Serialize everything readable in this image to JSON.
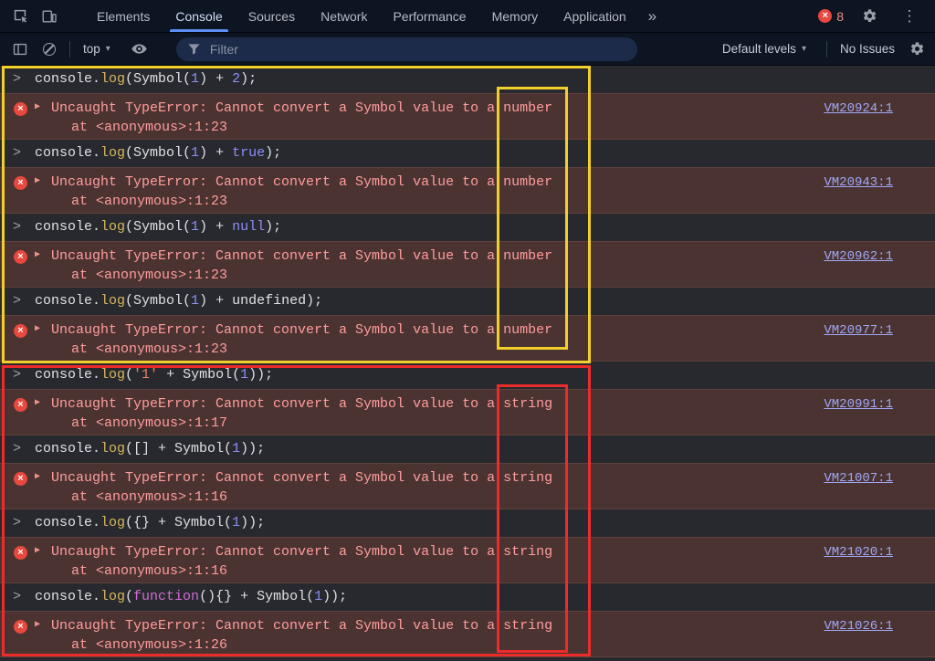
{
  "theme": {
    "toolbar_bg": "#0d1422",
    "console_bg": "#27292e",
    "tab_text": "#b6bcc4",
    "selected_tab_text": "#d3def7",
    "accent_blue": "#5b8ef5",
    "badge_red": "#e8483e",
    "filter_bg": "#1c2b49",
    "error_row_bg": "#4b3331",
    "error_border": "#5e413d",
    "error_text": "#ff9d9d",
    "link_color": "#9fa8f5",
    "annotation_yellow": "#f2cf2a",
    "annotation_red": "#ec2b2b",
    "token_plain": "#dfe1e5",
    "token_function": "#d8b65c",
    "token_number": "#8e8ef7",
    "token_keyword": "#8e8ef7",
    "token_string": "#ea8262",
    "token_function_keyword": "#d06ed0"
  },
  "icons": {
    "prompt": ">",
    "expand_triangle": "▶",
    "error_x": "×",
    "caret": "▾",
    "kebab": "⋮",
    "overflow_chevron": "»"
  },
  "tabbar": {
    "tabs": [
      "Elements",
      "Console",
      "Sources",
      "Network",
      "Performance",
      "Memory",
      "Application"
    ],
    "selected_tab": "Console",
    "error_count": "8"
  },
  "toolbar": {
    "context_label": "top",
    "filter_placeholder": "Filter",
    "filter_value": "",
    "levels_label": "Default levels",
    "issues_label": "No Issues"
  },
  "console": {
    "entries": [
      {
        "kind": "command",
        "segments": [
          {
            "text": "console.",
            "cls": "plain"
          },
          {
            "text": "log",
            "cls": "fn"
          },
          {
            "text": "(Symbol(",
            "cls": "plain"
          },
          {
            "text": "1",
            "cls": "num"
          },
          {
            "text": ") + ",
            "cls": "plain"
          },
          {
            "text": "2",
            "cls": "num"
          },
          {
            "text": ");",
            "cls": "plain"
          }
        ]
      },
      {
        "kind": "error",
        "message": "Uncaught TypeError: Cannot convert a Symbol value to a ",
        "word": "number",
        "location": "at <anonymous>:1:23",
        "link": "VM20924:1"
      },
      {
        "kind": "command",
        "segments": [
          {
            "text": "console.",
            "cls": "plain"
          },
          {
            "text": "log",
            "cls": "fn"
          },
          {
            "text": "(Symbol(",
            "cls": "plain"
          },
          {
            "text": "1",
            "cls": "num"
          },
          {
            "text": ") + ",
            "cls": "plain"
          },
          {
            "text": "true",
            "cls": "kw"
          },
          {
            "text": ");",
            "cls": "plain"
          }
        ]
      },
      {
        "kind": "error",
        "message": "Uncaught TypeError: Cannot convert a Symbol value to a ",
        "word": "number",
        "location": "at <anonymous>:1:23",
        "link": "VM20943:1"
      },
      {
        "kind": "command",
        "segments": [
          {
            "text": "console.",
            "cls": "plain"
          },
          {
            "text": "log",
            "cls": "fn"
          },
          {
            "text": "(Symbol(",
            "cls": "plain"
          },
          {
            "text": "1",
            "cls": "num"
          },
          {
            "text": ") + ",
            "cls": "plain"
          },
          {
            "text": "null",
            "cls": "kw"
          },
          {
            "text": ");",
            "cls": "plain"
          }
        ]
      },
      {
        "kind": "error",
        "message": "Uncaught TypeError: Cannot convert a Symbol value to a ",
        "word": "number",
        "location": "at <anonymous>:1:23",
        "link": "VM20962:1"
      },
      {
        "kind": "command",
        "segments": [
          {
            "text": "console.",
            "cls": "plain"
          },
          {
            "text": "log",
            "cls": "fn"
          },
          {
            "text": "(Symbol(",
            "cls": "plain"
          },
          {
            "text": "1",
            "cls": "num"
          },
          {
            "text": ") + undefined);",
            "cls": "plain"
          }
        ]
      },
      {
        "kind": "error",
        "message": "Uncaught TypeError: Cannot convert a Symbol value to a ",
        "word": "number",
        "location": "at <anonymous>:1:23",
        "link": "VM20977:1"
      },
      {
        "kind": "command",
        "segments": [
          {
            "text": "console.",
            "cls": "plain"
          },
          {
            "text": "log",
            "cls": "fn"
          },
          {
            "text": "(",
            "cls": "plain"
          },
          {
            "text": "'1'",
            "cls": "str"
          },
          {
            "text": " + Symbol(",
            "cls": "plain"
          },
          {
            "text": "1",
            "cls": "num"
          },
          {
            "text": "));",
            "cls": "plain"
          }
        ]
      },
      {
        "kind": "error",
        "message": "Uncaught TypeError: Cannot convert a Symbol value to a ",
        "word": "string",
        "location": "at <anonymous>:1:17",
        "link": "VM20991:1"
      },
      {
        "kind": "command",
        "segments": [
          {
            "text": "console.",
            "cls": "plain"
          },
          {
            "text": "log",
            "cls": "fn"
          },
          {
            "text": "([] + Symbol(",
            "cls": "plain"
          },
          {
            "text": "1",
            "cls": "num"
          },
          {
            "text": "));",
            "cls": "plain"
          }
        ]
      },
      {
        "kind": "error",
        "message": "Uncaught TypeError: Cannot convert a Symbol value to a ",
        "word": "string",
        "location": "at <anonymous>:1:16",
        "link": "VM21007:1"
      },
      {
        "kind": "command",
        "segments": [
          {
            "text": "console.",
            "cls": "plain"
          },
          {
            "text": "log",
            "cls": "fn"
          },
          {
            "text": "({} + Symbol(",
            "cls": "plain"
          },
          {
            "text": "1",
            "cls": "num"
          },
          {
            "text": "));",
            "cls": "plain"
          }
        ]
      },
      {
        "kind": "error",
        "message": "Uncaught TypeError: Cannot convert a Symbol value to a ",
        "word": "string",
        "location": "at <anonymous>:1:16",
        "link": "VM21020:1"
      },
      {
        "kind": "command",
        "segments": [
          {
            "text": "console.",
            "cls": "plain"
          },
          {
            "text": "log",
            "cls": "fn"
          },
          {
            "text": "(",
            "cls": "plain"
          },
          {
            "text": "function",
            "cls": "fnkw"
          },
          {
            "text": "(){} + Symbol(",
            "cls": "plain"
          },
          {
            "text": "1",
            "cls": "num"
          },
          {
            "text": "));",
            "cls": "plain"
          }
        ]
      },
      {
        "kind": "error",
        "message": "Uncaught TypeError: Cannot convert a Symbol value to a ",
        "word": "string",
        "location": "at <anonymous>:1:26",
        "link": "VM21026:1"
      }
    ]
  }
}
